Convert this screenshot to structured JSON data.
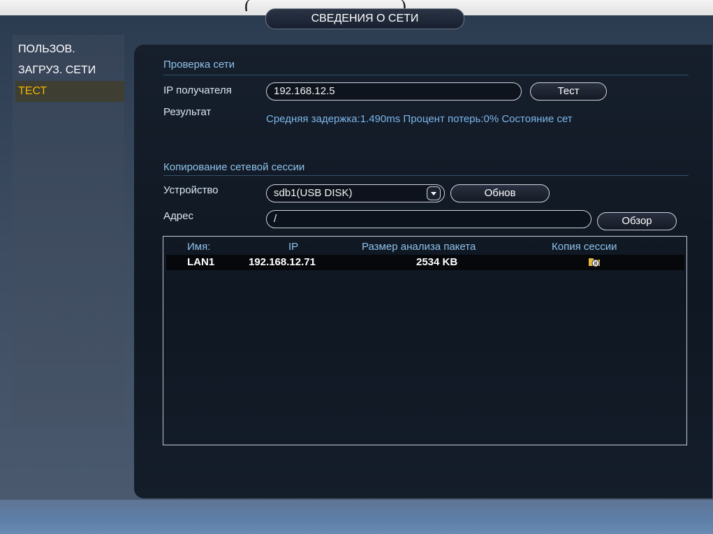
{
  "title": "СВЕДЕНИЯ О СЕТИ",
  "sidebar": {
    "items": [
      {
        "label": "ПОЛЬЗОВ."
      },
      {
        "label": "ЗАГРУЗ. СЕТИ"
      },
      {
        "label": "ТЕСТ",
        "active": true
      }
    ]
  },
  "network_check": {
    "section_title": "Проверка сети",
    "ip_label": "IP получателя",
    "ip_value": "192.168.12.5",
    "test_button": "Тест",
    "result_label": "Результат",
    "result_value": "Средняя задержка:1.490ms Процент потерь:0% Состояние сет"
  },
  "session_copy": {
    "section_title": "Копирование сетевой сессии",
    "device_label": "Устройство",
    "device_value": "sdb1(USB DISK)",
    "refresh_button": "Обнов",
    "address_label": "Адрес",
    "address_value": "/",
    "browse_button": "Обзор"
  },
  "table": {
    "columns": [
      "Имя:",
      "IP",
      "Размер анализа пакета",
      "Копия сессии"
    ],
    "rows": [
      {
        "name": "LAN1",
        "ip": "192.168.12.71",
        "size": "2534 KB",
        "copy_icon": "folder-pause-icon"
      }
    ]
  },
  "colors": {
    "accent": "#f0b400",
    "section_text": "#8fc2ea",
    "result_text": "#7cb6ea"
  }
}
